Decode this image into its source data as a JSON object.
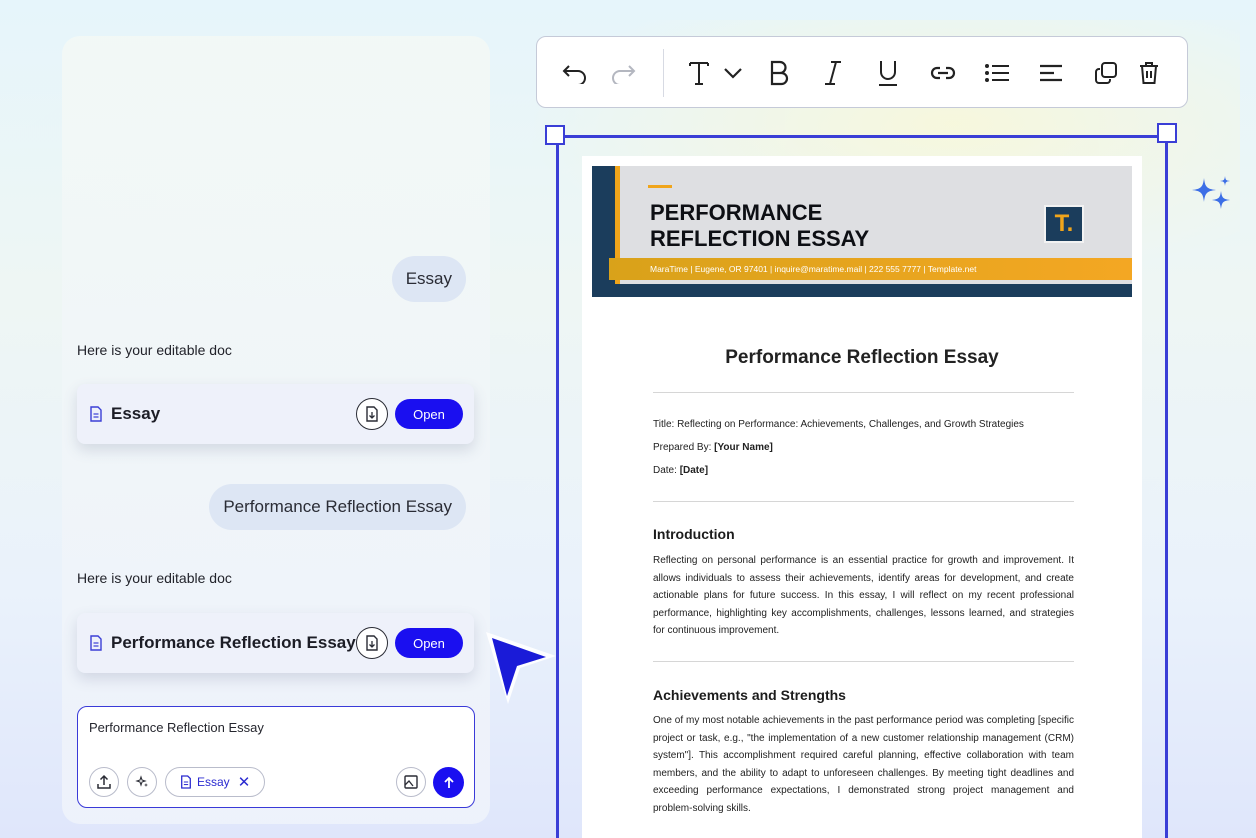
{
  "chat": {
    "user_message_1": "Essay",
    "assistant_text_1": "Here is your editable doc",
    "doc_card_1": {
      "name": "Essay",
      "open_label": "Open"
    },
    "user_message_2": "Performance Reflection Essay",
    "assistant_text_2": "Here is your editable doc",
    "doc_card_2": {
      "name": "Performance Reflection Essay",
      "open_label": "Open"
    },
    "composer": {
      "text": "Performance Reflection Essay",
      "chip_label": "Essay"
    }
  },
  "toolbar": {
    "icons": [
      "undo-icon",
      "redo-icon",
      "text-style-icon",
      "chevron-down-icon",
      "bold-icon",
      "italic-icon",
      "underline-icon",
      "link-icon",
      "list-icon",
      "align-left-icon",
      "duplicate-icon",
      "delete-icon"
    ]
  },
  "document": {
    "banner_title": "PERFORMANCE REFLECTION ESSAY",
    "banner_info": "MaraTime | Eugene, OR 97401 | inquire@maratime.mail | 222 555 7777 | Template.net",
    "logo_letter": "T.",
    "heading": "Performance Reflection Essay",
    "meta_title": "Title: Reflecting on Performance: Achievements, Challenges, and Growth Strategies",
    "meta_prepared_label": "Prepared By:",
    "meta_prepared_value": "[Your Name]",
    "meta_date_label": "Date:",
    "meta_date_value": "[Date]",
    "section1_title": "Introduction",
    "section1_body": "Reflecting on personal performance is an essential practice for growth and improvement. It allows individuals to assess their achievements, identify areas for development, and create actionable plans for future success. In this essay, I will reflect on my recent professional performance, highlighting key accomplishments, challenges, lessons learned, and strategies for continuous improvement.",
    "section2_title": "Achievements and Strengths",
    "section2_body": "One of my most notable achievements in the past performance period was completing [specific project or task, e.g., \"the implementation of a new customer relationship management (CRM) system\"]. This accomplishment required careful planning, effective collaboration with team members, and the ability to adapt to unforeseen challenges. By meeting tight deadlines and exceeding performance expectations, I demonstrated strong project management and problem-solving skills."
  },
  "colors": {
    "accent_blue": "#1a0ff0",
    "frame_blue": "#3a3ed6",
    "banner_navy": "#1b3d5c",
    "banner_gold": "#f0a51b"
  }
}
